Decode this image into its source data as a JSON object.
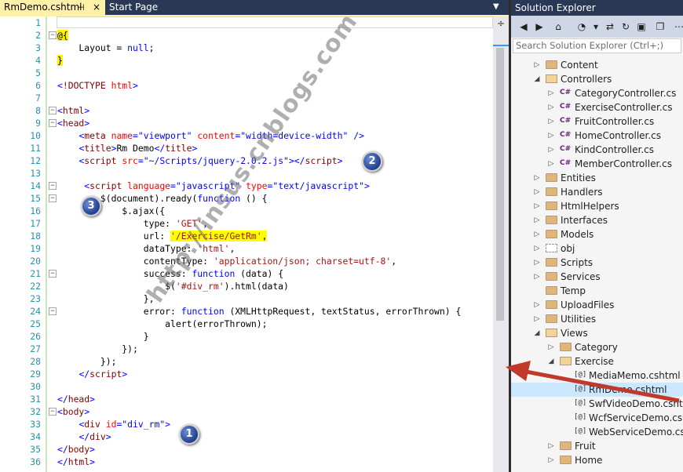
{
  "tabs": {
    "active_label": "RmDemo.cshtml",
    "pin_glyph": "⊣",
    "close_glyph": "×",
    "start_label": "Start Page",
    "dropdown_glyph": "▼"
  },
  "editor": {
    "split_glyph": "÷",
    "lines": [
      {
        "n": "1",
        "html": ""
      },
      {
        "n": "2",
        "html": "<span class=\"raz\">@{</span>"
      },
      {
        "n": "3",
        "html": "    Layout = <span class=\"k\">null</span>;"
      },
      {
        "n": "4",
        "html": "<span class=\"raz\">}</span>"
      },
      {
        "n": "5",
        "html": ""
      },
      {
        "n": "6",
        "html": "<span class=\"v\">&lt;</span><span class=\"t\">!DOCTYPE</span> <span class=\"a\">html</span><span class=\"v\">&gt;</span>"
      },
      {
        "n": "7",
        "html": ""
      },
      {
        "n": "8",
        "html": "<span class=\"v\">&lt;</span><span class=\"t\">html</span><span class=\"v\">&gt;</span>"
      },
      {
        "n": "9",
        "html": "<span class=\"v\">&lt;</span><span class=\"t\">head</span><span class=\"v\">&gt;</span>"
      },
      {
        "n": "10",
        "html": "    <span class=\"v\">&lt;</span><span class=\"t\">meta</span> <span class=\"a\">name</span><span class=\"v\">=\"viewport\"</span> <span class=\"a\">content</span><span class=\"v\">=\"width=device-width\"</span> <span class=\"v\">/&gt;</span>"
      },
      {
        "n": "11",
        "html": "    <span class=\"v\">&lt;</span><span class=\"t\">title</span><span class=\"v\">&gt;</span>Rm Demo<span class=\"v\">&lt;/</span><span class=\"t\">title</span><span class=\"v\">&gt;</span>"
      },
      {
        "n": "12",
        "html": "    <span class=\"v\">&lt;</span><span class=\"t\">script</span> <span class=\"a\">src</span><span class=\"v\">=\"~/Scripts/jquery-2.0.2.js\"&gt;&lt;/</span><span class=\"t\">script</span><span class=\"v\">&gt;</span>"
      },
      {
        "n": "13",
        "html": ""
      },
      {
        "n": "14",
        "html": "     <span class=\"v\">&lt;</span><span class=\"t\">script</span> <span class=\"a\">language</span><span class=\"v\">=\"javascript\"</span> <span class=\"a\">type</span><span class=\"v\">=\"text/javascript\"&gt;</span>"
      },
      {
        "n": "15",
        "html": "        $(document).ready(<span class=\"k\">function</span> () {"
      },
      {
        "n": "16",
        "html": "            $.ajax({"
      },
      {
        "n": "17",
        "html": "                type: <span class=\"s\">'GET'</span>,"
      },
      {
        "n": "18",
        "html": "                url: <span class=\"hl\"><span class=\"s\">'/Exercise/GetRm'</span>,</span>"
      },
      {
        "n": "19",
        "html": "                dataType: <span class=\"s\">'html'</span>,"
      },
      {
        "n": "20",
        "html": "                contentType: <span class=\"s\">'application/json; charset=utf-8'</span>,"
      },
      {
        "n": "21",
        "html": "                success: <span class=\"k\">function</span> (data) {"
      },
      {
        "n": "22",
        "html": "                    $(<span class=\"s\">'#div_rm'</span>).html(data)"
      },
      {
        "n": "23",
        "html": "                },"
      },
      {
        "n": "24",
        "html": "                error: <span class=\"k\">function</span> (XMLHttpRequest, textStatus, errorThrown) {"
      },
      {
        "n": "25",
        "html": "                    alert(errorThrown);"
      },
      {
        "n": "26",
        "html": "                }"
      },
      {
        "n": "27",
        "html": "            });"
      },
      {
        "n": "28",
        "html": "        });"
      },
      {
        "n": "29",
        "html": "    <span class=\"v\">&lt;/</span><span class=\"t\">script</span><span class=\"v\">&gt;</span>"
      },
      {
        "n": "30",
        "html": ""
      },
      {
        "n": "31",
        "html": "<span class=\"v\">&lt;/</span><span class=\"t\">head</span><span class=\"v\">&gt;</span>"
      },
      {
        "n": "32",
        "html": "<span class=\"v\">&lt;</span><span class=\"t\">body</span><span class=\"v\">&gt;</span>"
      },
      {
        "n": "33",
        "html": "    <span class=\"v\">&lt;</span><span class=\"t\">div</span> <span class=\"a\">id</span><span class=\"v\">=\"div_rm\"&gt;</span>"
      },
      {
        "n": "34",
        "html": "    <span class=\"v\">&lt;/</span><span class=\"t\">div</span><span class=\"v\">&gt;</span>"
      },
      {
        "n": "35",
        "html": "<span class=\"v\">&lt;/</span><span class=\"t\">body</span><span class=\"v\">&gt;</span>"
      },
      {
        "n": "36",
        "html": "<span class=\"v\">&lt;/</span><span class=\"t\">html</span><span class=\"v\">&gt;</span>"
      }
    ],
    "fold_lines": [
      "2",
      "8",
      "9",
      "14",
      "15",
      "21",
      "24",
      "32"
    ]
  },
  "annotations": {
    "badge_1": "1",
    "badge_2": "2",
    "badge_3": "3",
    "watermark": "http://insus.cnblogs.com"
  },
  "solution_explorer": {
    "title": "Solution Explorer",
    "search_placeholder": "Search Solution Explorer (Ctrl+;)",
    "toolbar_icons": [
      "back-icon",
      "forward-icon",
      "home-icon",
      "history-icon",
      "dropdown-icon",
      "sync-icon",
      "refresh-icon",
      "collapse-all-icon",
      "show-all-files-icon",
      "properties-icon"
    ],
    "toolbar_glyphs": [
      "◀",
      "▶",
      "⌂",
      "◔",
      "▾",
      "⇄",
      "↻",
      "▣",
      "❐",
      "⋯"
    ],
    "items": [
      {
        "label": "Content",
        "indent": 1,
        "type": "folder",
        "expand": "▷"
      },
      {
        "label": "Controllers",
        "indent": 1,
        "type": "folder-open",
        "expand": "◢"
      },
      {
        "label": "CategoryController.cs",
        "indent": 2,
        "type": "cs",
        "expand": "▷"
      },
      {
        "label": "ExerciseController.cs",
        "indent": 2,
        "type": "cs",
        "expand": "▷"
      },
      {
        "label": "FruitController.cs",
        "indent": 2,
        "type": "cs",
        "expand": "▷"
      },
      {
        "label": "HomeController.cs",
        "indent": 2,
        "type": "cs",
        "expand": "▷"
      },
      {
        "label": "KindController.cs",
        "indent": 2,
        "type": "cs",
        "expand": "▷"
      },
      {
        "label": "MemberController.cs",
        "indent": 2,
        "type": "cs",
        "expand": "▷"
      },
      {
        "label": "Entities",
        "indent": 1,
        "type": "folder",
        "expand": "▷"
      },
      {
        "label": "Handlers",
        "indent": 1,
        "type": "folder",
        "expand": "▷"
      },
      {
        "label": "HtmlHelpers",
        "indent": 1,
        "type": "folder",
        "expand": "▷"
      },
      {
        "label": "Interfaces",
        "indent": 1,
        "type": "folder",
        "expand": "▷"
      },
      {
        "label": "Models",
        "indent": 1,
        "type": "folder",
        "expand": "▷"
      },
      {
        "label": "obj",
        "indent": 1,
        "type": "folder-dash",
        "expand": "▷"
      },
      {
        "label": "Scripts",
        "indent": 1,
        "type": "folder",
        "expand": "▷"
      },
      {
        "label": "Services",
        "indent": 1,
        "type": "folder",
        "expand": "▷"
      },
      {
        "label": "Temp",
        "indent": 1,
        "type": "folder",
        "expand": ""
      },
      {
        "label": "UploadFiles",
        "indent": 1,
        "type": "folder",
        "expand": "▷"
      },
      {
        "label": "Utilities",
        "indent": 1,
        "type": "folder",
        "expand": "▷"
      },
      {
        "label": "Views",
        "indent": 1,
        "type": "folder-open",
        "expand": "◢"
      },
      {
        "label": "Category",
        "indent": 2,
        "type": "folder",
        "expand": "▷"
      },
      {
        "label": "Exercise",
        "indent": 2,
        "type": "folder-open",
        "expand": "◢"
      },
      {
        "label": "MediaMemo.cshtml",
        "indent": 3,
        "type": "razor",
        "expand": ""
      },
      {
        "label": "RmDemo.cshtml",
        "indent": 3,
        "type": "razor",
        "expand": "",
        "selected": true
      },
      {
        "label": "SwfVideoDemo.cshtml",
        "indent": 3,
        "type": "razor",
        "expand": ""
      },
      {
        "label": "WcfServiceDemo.cshtml",
        "indent": 3,
        "type": "razor",
        "expand": ""
      },
      {
        "label": "WebServiceDemo.cshtml",
        "indent": 3,
        "type": "razor",
        "expand": ""
      },
      {
        "label": "Fruit",
        "indent": 2,
        "type": "folder",
        "expand": "▷"
      },
      {
        "label": "Home",
        "indent": 2,
        "type": "folder",
        "expand": "▷"
      }
    ],
    "cs_badge": "C#",
    "razor_badge": "[@]"
  }
}
